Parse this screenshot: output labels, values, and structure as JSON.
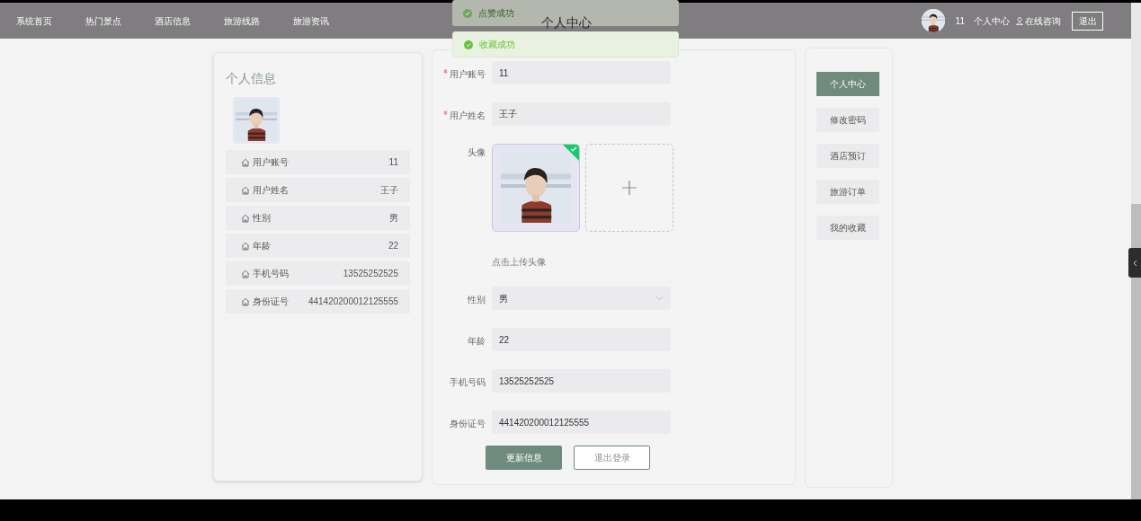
{
  "nav": {
    "items": [
      {
        "label": "系统首页",
        "selected": false
      },
      {
        "label": "热门景点",
        "selected": false
      },
      {
        "label": "酒店信息",
        "selected": false
      },
      {
        "label": "旅游线路",
        "selected": false
      },
      {
        "label": "旅游资讯",
        "selected": false
      }
    ],
    "username": "11",
    "center_link": "个人中心",
    "consult_link": "在线咨询",
    "logout": "退出"
  },
  "toasts": [
    {
      "text": "点赞成功",
      "faded": true
    },
    {
      "text": "收藏成功",
      "faded": false
    }
  ],
  "page_title": "个人中心",
  "info_card": {
    "title": "个人信息",
    "rows": [
      {
        "label": "用户账号",
        "value": "11"
      },
      {
        "label": "用户姓名",
        "value": "王子"
      },
      {
        "label": "性别",
        "value": "男"
      },
      {
        "label": "年龄",
        "value": "22"
      },
      {
        "label": "手机号码",
        "value": "13525252525"
      },
      {
        "label": "身份证号",
        "value": "441420200012125555"
      }
    ]
  },
  "form": {
    "fields": [
      {
        "kind": "input",
        "label": "用户账号",
        "required": true,
        "value": "11"
      },
      {
        "kind": "input",
        "label": "用户姓名",
        "required": true,
        "value": "王子"
      },
      {
        "kind": "upload",
        "label": "头像",
        "required": false,
        "hint": "点击上传头像"
      },
      {
        "kind": "select",
        "label": "性别",
        "required": false,
        "value": "男"
      },
      {
        "kind": "input",
        "label": "年龄",
        "required": false,
        "value": "22"
      },
      {
        "kind": "input",
        "label": "手机号码",
        "required": false,
        "value": "13525252525"
      },
      {
        "kind": "input",
        "label": "身份证号",
        "required": false,
        "value": "441420200012125555"
      }
    ],
    "buttons": [
      {
        "label": "更新信息",
        "kind": "primary"
      },
      {
        "label": "退出登录",
        "kind": "outline"
      }
    ]
  },
  "side_menu": [
    {
      "label": "个人中心",
      "selected": true
    },
    {
      "label": "修改密码",
      "selected": false
    },
    {
      "label": "酒店预订",
      "selected": false
    },
    {
      "label": "旅游订单",
      "selected": false
    },
    {
      "label": "我的收藏",
      "selected": false
    }
  ]
}
